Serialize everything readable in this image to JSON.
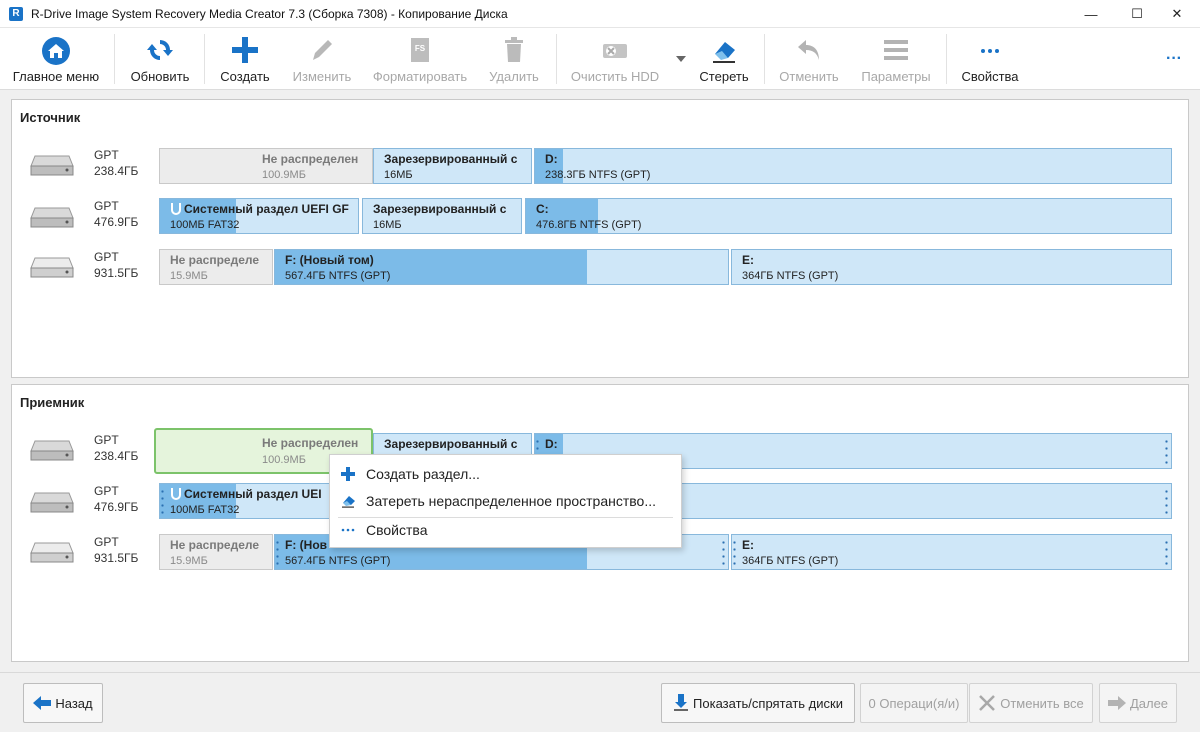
{
  "window": {
    "title": "R-Drive Image System Recovery Media Creator 7.3 (Сборка 7308) - Копирование Диска",
    "app_icon_letter": "R",
    "controls": {
      "minimize": "—",
      "maximize": "☐",
      "close": "✕"
    }
  },
  "toolbar": {
    "home": "Главное меню",
    "refresh": "Обновить",
    "create": "Создать",
    "edit": "Изменить",
    "format": "Форматировать",
    "delete": "Удалить",
    "clear_hdd": "Очистить HDD",
    "wipe": "Стереть",
    "undo": "Отменить",
    "params": "Параметры",
    "properties": "Свойства",
    "more": "···"
  },
  "source": {
    "title": "Источник",
    "disks": [
      {
        "type": "GPT",
        "size": "238.4ГБ",
        "partitions": [
          {
            "name": "Не распределен",
            "info": "100.9МБ"
          },
          {
            "name": "Зарезервированный с",
            "info": "16МБ"
          },
          {
            "name": "D:",
            "info": "238.3ГБ NTFS (GPT)",
            "used_fraction": 0.03
          }
        ]
      },
      {
        "type": "GPT",
        "size": "476.9ГБ",
        "partitions": [
          {
            "name": "Системный раздел UEFI GF",
            "info": "100МБ FAT32"
          },
          {
            "name": "Зарезервированный с",
            "info": "16МБ"
          },
          {
            "name": "C:",
            "info": "476.8ГБ NTFS (GPT)",
            "used_fraction": 0.11
          }
        ]
      },
      {
        "type": "GPT",
        "size": "931.5ГБ",
        "partitions": [
          {
            "name": "Не распределе",
            "info": "15.9МБ"
          },
          {
            "name": "F: (Новый том)",
            "info": "567.4ГБ NTFS (GPT)",
            "used_fraction": 0.69
          },
          {
            "name": "E:",
            "info": "364ГБ NTFS (GPT)",
            "used_fraction": 0.0
          }
        ]
      }
    ]
  },
  "target": {
    "title": "Приемник",
    "disks": [
      {
        "type": "GPT",
        "size": "238.4ГБ",
        "partitions": [
          {
            "name": "Не распределен",
            "info": "100.9МБ"
          },
          {
            "name": "Зарезервированный с",
            "info": ""
          },
          {
            "name": "D:",
            "info": ""
          }
        ]
      },
      {
        "type": "GPT",
        "size": "476.9ГБ",
        "partitions": [
          {
            "name": "Системный раздел UEI",
            "info": "100МБ FAT32"
          }
        ]
      },
      {
        "type": "GPT",
        "size": "931.5ГБ",
        "partitions": [
          {
            "name": "Не распределе",
            "info": "15.9МБ"
          },
          {
            "name": "F: (Нов",
            "info": "567.4ГБ NTFS (GPT)"
          },
          {
            "name": "E:",
            "info": "364ГБ NTFS (GPT)"
          }
        ]
      }
    ]
  },
  "context_menu": {
    "items": [
      {
        "label": "Создать раздел..."
      },
      {
        "label": "Затереть нераспределенное пространство..."
      },
      {
        "label": "Свойства"
      }
    ]
  },
  "bottom": {
    "back": "Назад",
    "show_hide": "Показать/спрятать диски",
    "operations": "0 Операци(я/и)",
    "cancel_all": "Отменить все",
    "next": "Далее"
  },
  "colors": {
    "accent": "#1a73c7",
    "partition_bg": "#cfe7f8",
    "partition_fill": "#7cbbe8",
    "selected_border": "#7cc36a"
  }
}
